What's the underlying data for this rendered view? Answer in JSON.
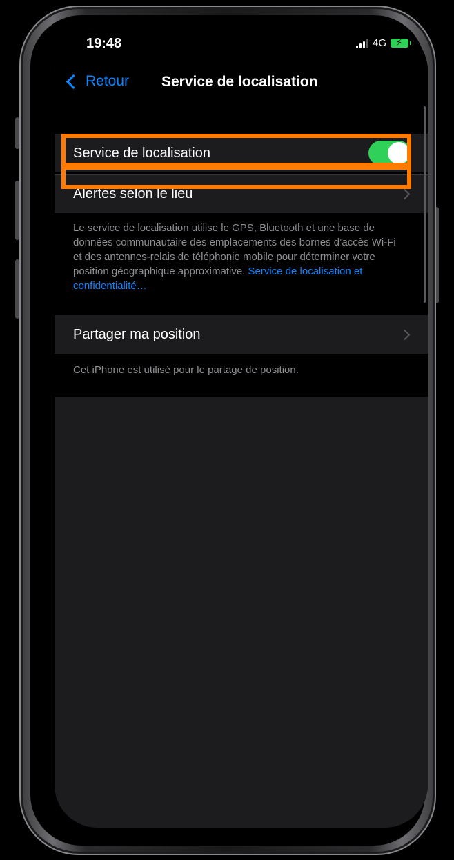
{
  "status_bar": {
    "time": "19:48",
    "network": "4G"
  },
  "nav": {
    "back_label": "Retour",
    "title": "Service de localisation"
  },
  "settings": {
    "location_service": {
      "label": "Service de localisation",
      "toggle_on": true
    },
    "alerts": {
      "label": "Alertes selon le lieu"
    },
    "description": {
      "text": "Le service de localisation utilise le GPS, Bluetooth et une base de données communautaire des emplacements des bornes d’accès Wi-Fi et des antennes-relais de téléphonie mobile pour déterminer votre position géographique approximative. ",
      "link": "Service de localisation et confidentialité…"
    },
    "share_position": {
      "label": "Partager ma position"
    },
    "share_footer": "Cet iPhone est utilisé pour le partage de position."
  },
  "colors": {
    "accent": "#0a84ff",
    "toggle_on": "#30d158",
    "highlight": "#ff7a00",
    "cell_bg": "#1c1c1e",
    "background": "#000000"
  },
  "icons": [
    "chevron-left-icon",
    "chevron-right-icon",
    "signal-icon",
    "battery-icon"
  ]
}
